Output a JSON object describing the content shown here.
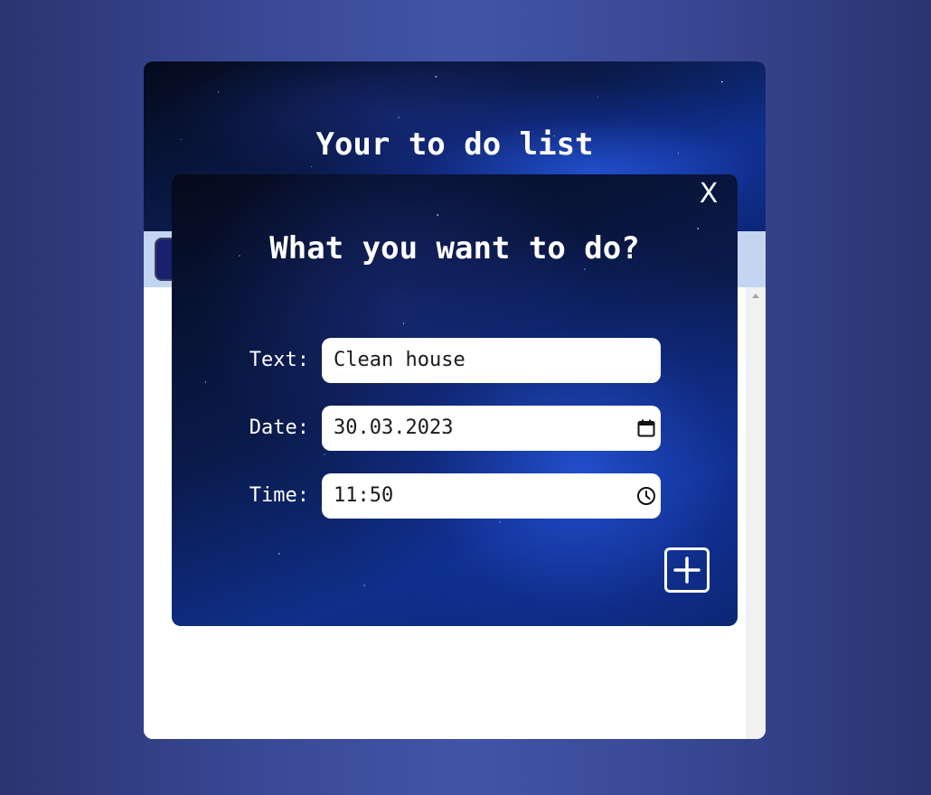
{
  "app": {
    "title": "Your to do list"
  },
  "modal": {
    "close_label": "X",
    "title": "What you want to do?",
    "fields": {
      "text": {
        "label": "Text:",
        "value": "Clean house"
      },
      "date": {
        "label": "Date:",
        "value": "30.03.2023",
        "icon": "calendar-icon"
      },
      "time": {
        "label": "Time:",
        "value": "11:50",
        "icon": "clock-icon"
      }
    },
    "add_button_icon": "plus-square-icon"
  },
  "colors": {
    "page_background": "#3a4a98",
    "toolbar_background": "#c3d5f0",
    "toolbar_button": "#1a1f6e",
    "field_background": "#ffffff",
    "text_on_dark": "#ffffff"
  }
}
